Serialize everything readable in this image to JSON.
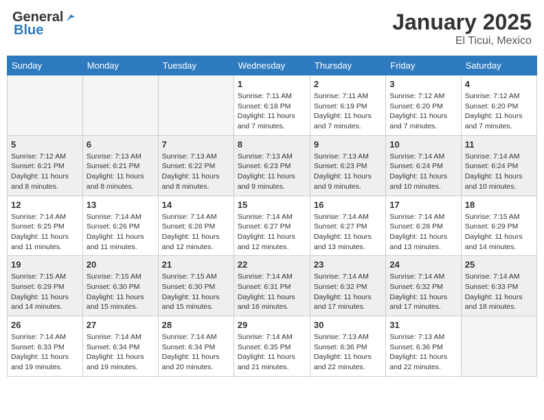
{
  "header": {
    "logo_general": "General",
    "logo_blue": "Blue",
    "month_title": "January 2025",
    "location": "El Ticui, Mexico"
  },
  "weekdays": [
    "Sunday",
    "Monday",
    "Tuesday",
    "Wednesday",
    "Thursday",
    "Friday",
    "Saturday"
  ],
  "weeks": [
    [
      {
        "day": "",
        "info": ""
      },
      {
        "day": "",
        "info": ""
      },
      {
        "day": "",
        "info": ""
      },
      {
        "day": "1",
        "info": "Sunrise: 7:11 AM\nSunset: 6:18 PM\nDaylight: 11 hours\nand 7 minutes."
      },
      {
        "day": "2",
        "info": "Sunrise: 7:11 AM\nSunset: 6:19 PM\nDaylight: 11 hours\nand 7 minutes."
      },
      {
        "day": "3",
        "info": "Sunrise: 7:12 AM\nSunset: 6:20 PM\nDaylight: 11 hours\nand 7 minutes."
      },
      {
        "day": "4",
        "info": "Sunrise: 7:12 AM\nSunset: 6:20 PM\nDaylight: 11 hours\nand 7 minutes."
      }
    ],
    [
      {
        "day": "5",
        "info": "Sunrise: 7:12 AM\nSunset: 6:21 PM\nDaylight: 11 hours\nand 8 minutes."
      },
      {
        "day": "6",
        "info": "Sunrise: 7:13 AM\nSunset: 6:21 PM\nDaylight: 11 hours\nand 8 minutes."
      },
      {
        "day": "7",
        "info": "Sunrise: 7:13 AM\nSunset: 6:22 PM\nDaylight: 11 hours\nand 8 minutes."
      },
      {
        "day": "8",
        "info": "Sunrise: 7:13 AM\nSunset: 6:23 PM\nDaylight: 11 hours\nand 9 minutes."
      },
      {
        "day": "9",
        "info": "Sunrise: 7:13 AM\nSunset: 6:23 PM\nDaylight: 11 hours\nand 9 minutes."
      },
      {
        "day": "10",
        "info": "Sunrise: 7:14 AM\nSunset: 6:24 PM\nDaylight: 11 hours\nand 10 minutes."
      },
      {
        "day": "11",
        "info": "Sunrise: 7:14 AM\nSunset: 6:24 PM\nDaylight: 11 hours\nand 10 minutes."
      }
    ],
    [
      {
        "day": "12",
        "info": "Sunrise: 7:14 AM\nSunset: 6:25 PM\nDaylight: 11 hours\nand 11 minutes."
      },
      {
        "day": "13",
        "info": "Sunrise: 7:14 AM\nSunset: 6:26 PM\nDaylight: 11 hours\nand 11 minutes."
      },
      {
        "day": "14",
        "info": "Sunrise: 7:14 AM\nSunset: 6:26 PM\nDaylight: 11 hours\nand 12 minutes."
      },
      {
        "day": "15",
        "info": "Sunrise: 7:14 AM\nSunset: 6:27 PM\nDaylight: 11 hours\nand 12 minutes."
      },
      {
        "day": "16",
        "info": "Sunrise: 7:14 AM\nSunset: 6:27 PM\nDaylight: 11 hours\nand 13 minutes."
      },
      {
        "day": "17",
        "info": "Sunrise: 7:14 AM\nSunset: 6:28 PM\nDaylight: 11 hours\nand 13 minutes."
      },
      {
        "day": "18",
        "info": "Sunrise: 7:15 AM\nSunset: 6:29 PM\nDaylight: 11 hours\nand 14 minutes."
      }
    ],
    [
      {
        "day": "19",
        "info": "Sunrise: 7:15 AM\nSunset: 6:29 PM\nDaylight: 11 hours\nand 14 minutes."
      },
      {
        "day": "20",
        "info": "Sunrise: 7:15 AM\nSunset: 6:30 PM\nDaylight: 11 hours\nand 15 minutes."
      },
      {
        "day": "21",
        "info": "Sunrise: 7:15 AM\nSunset: 6:30 PM\nDaylight: 11 hours\nand 15 minutes."
      },
      {
        "day": "22",
        "info": "Sunrise: 7:14 AM\nSunset: 6:31 PM\nDaylight: 11 hours\nand 16 minutes."
      },
      {
        "day": "23",
        "info": "Sunrise: 7:14 AM\nSunset: 6:32 PM\nDaylight: 11 hours\nand 17 minutes."
      },
      {
        "day": "24",
        "info": "Sunrise: 7:14 AM\nSunset: 6:32 PM\nDaylight: 11 hours\nand 17 minutes."
      },
      {
        "day": "25",
        "info": "Sunrise: 7:14 AM\nSunset: 6:33 PM\nDaylight: 11 hours\nand 18 minutes."
      }
    ],
    [
      {
        "day": "26",
        "info": "Sunrise: 7:14 AM\nSunset: 6:33 PM\nDaylight: 11 hours\nand 19 minutes."
      },
      {
        "day": "27",
        "info": "Sunrise: 7:14 AM\nSunset: 6:34 PM\nDaylight: 11 hours\nand 19 minutes."
      },
      {
        "day": "28",
        "info": "Sunrise: 7:14 AM\nSunset: 6:34 PM\nDaylight: 11 hours\nand 20 minutes."
      },
      {
        "day": "29",
        "info": "Sunrise: 7:14 AM\nSunset: 6:35 PM\nDaylight: 11 hours\nand 21 minutes."
      },
      {
        "day": "30",
        "info": "Sunrise: 7:13 AM\nSunset: 6:36 PM\nDaylight: 11 hours\nand 22 minutes."
      },
      {
        "day": "31",
        "info": "Sunrise: 7:13 AM\nSunset: 6:36 PM\nDaylight: 11 hours\nand 22 minutes."
      },
      {
        "day": "",
        "info": ""
      }
    ]
  ]
}
